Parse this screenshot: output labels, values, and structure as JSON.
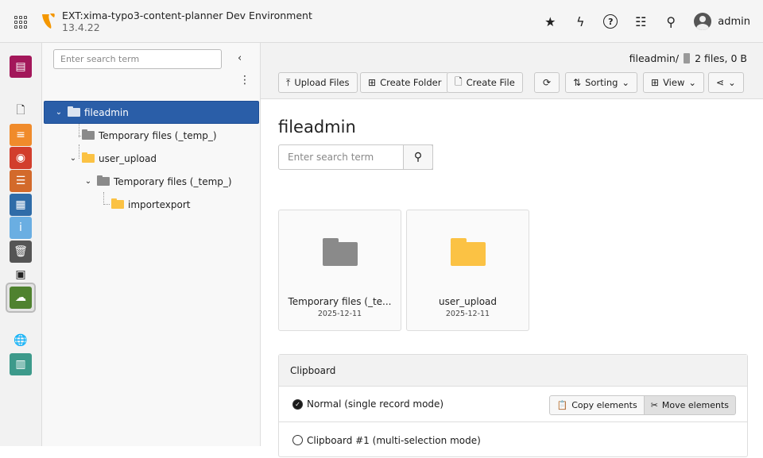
{
  "header": {
    "title": "EXT:xima-typo3-content-planner Dev Environment",
    "version": "13.4.22",
    "user": "admin",
    "icons": [
      "app-grid-icon",
      "typo3-logo",
      "star-icon",
      "bolt-icon",
      "help-icon",
      "list-icon",
      "search-icon",
      "avatar"
    ]
  },
  "modules": [
    {
      "name": "page-module",
      "color": "#a3175a",
      "glyph": "▤"
    },
    {
      "name": "page-icon",
      "color": "",
      "glyph": "🗋"
    },
    {
      "name": "list-module",
      "color": "#f08b2b",
      "glyph": "≡"
    },
    {
      "name": "view-module",
      "color": "#d23e2c",
      "glyph": "◉"
    },
    {
      "name": "records-module",
      "color": "#d36a2b",
      "glyph": "☰"
    },
    {
      "name": "forms-module",
      "color": "#2f6ca8",
      "glyph": "▦"
    },
    {
      "name": "info-module",
      "color": "#6aaee2",
      "glyph": "i"
    },
    {
      "name": "recycler-module",
      "color": "#555555",
      "glyph": "🗑"
    },
    {
      "name": "media-icon",
      "color": "",
      "glyph": "▣"
    },
    {
      "name": "filelist-module",
      "color": "#4f822f",
      "glyph": "☁"
    },
    {
      "name": "sites-icon",
      "color": "",
      "glyph": "🌐"
    },
    {
      "name": "template-module",
      "color": "#3d9a8b",
      "glyph": "▥"
    }
  ],
  "tree": {
    "search_placeholder": "Enter search term",
    "nodes": [
      {
        "label": "fileadmin"
      },
      {
        "label": "Temporary files (_temp_)"
      },
      {
        "label": "user_upload"
      },
      {
        "label": "Temporary files (_temp_)"
      },
      {
        "label": "importexport"
      }
    ]
  },
  "toolbar": {
    "path": "fileadmin/",
    "summary": "2 files, 0 B",
    "upload": "Upload Files",
    "create_folder": "Create Folder",
    "create_file": "Create File",
    "sorting": "Sorting",
    "view": "View"
  },
  "main": {
    "title": "fileadmin",
    "search_placeholder": "Enter search term",
    "cards": [
      {
        "name": "Temporary files (_te...",
        "date": "2025-12-11",
        "color": "#8a8a8a"
      },
      {
        "name": "user_upload",
        "date": "2025-12-11",
        "color": "#fbc244"
      }
    ]
  },
  "clipboard": {
    "title": "Clipboard",
    "normal": "Normal (single record mode)",
    "copy": "Copy elements",
    "move": "Move elements",
    "multi": "Clipboard #1 (multi-selection mode)"
  }
}
